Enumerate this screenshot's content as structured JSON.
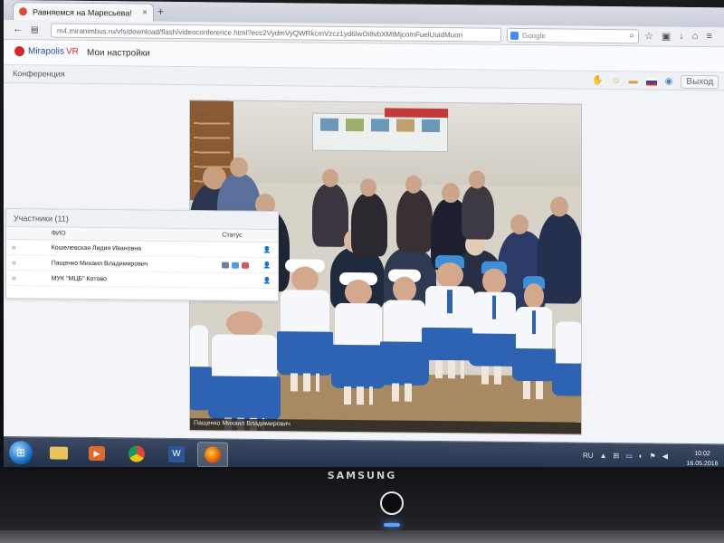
{
  "browser": {
    "tab_title": "Равняемся на Маресьева!",
    "tab_close": "×",
    "new_tab": "+",
    "url": "m4.miranimbus.ru/vfs/download/flash/videoconference.html?ecc2VydmVyQWRkcmVzcz1yd6lwOi8vbXMtMjcomFuelUuidMuon",
    "url_host": "m4.miranimbus.ru",
    "search_placeholder": "Google",
    "window_controls": [
      "–",
      "▢",
      "✕"
    ]
  },
  "app": {
    "logo_text": "Mirapolis",
    "logo_suffix": "VR",
    "settings_link": "Мои настройки",
    "section_title": "Конференция",
    "exit_label": "Выход"
  },
  "participants": {
    "title": "Участники (11)",
    "col_name": "ФИО",
    "col_status": "Статус",
    "rows": [
      {
        "name": "Кошелевская Лидия Ивановна"
      },
      {
        "name": "Пащенко Михаил Владимирович"
      },
      {
        "name": "МУК \"МЦБ\" Котово"
      }
    ]
  },
  "video": {
    "caption": "Пащенко Михаил Владимирович"
  },
  "monitor": {
    "brand": "SAMSUNG"
  },
  "taskbar": {
    "language": "RU",
    "time": "10:02",
    "date": "16.05.2016"
  },
  "colors": {
    "accent": "#2e63b4",
    "brand_red": "#d8262c",
    "taskbar": "#23304a"
  }
}
